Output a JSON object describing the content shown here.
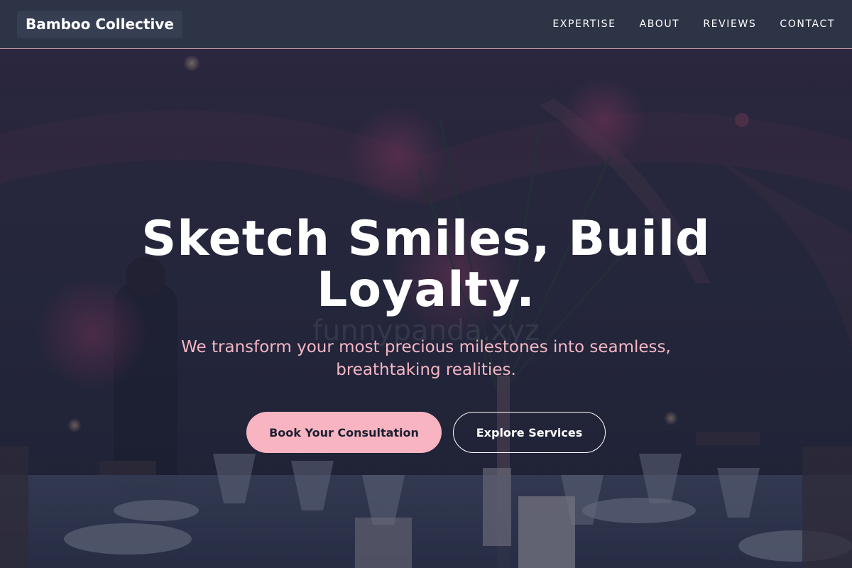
{
  "header": {
    "brand": "Bamboo Collective",
    "nav": [
      {
        "label": "EXPERTISE"
      },
      {
        "label": "ABOUT"
      },
      {
        "label": "REVIEWS"
      },
      {
        "label": "CONTACT"
      }
    ]
  },
  "hero": {
    "title": "Sketch Smiles, Build Loyalty.",
    "subtitle": "We transform your most precious milestones into seamless, breathtaking realities.",
    "watermark": "funnypanda.xyz",
    "primary_cta": "Book Your Consultation",
    "secondary_cta": "Explore Services"
  },
  "colors": {
    "header_bg": "#2d3446",
    "accent_pink": "#f8b4c1",
    "subtitle_pink": "#f4b6c4",
    "overlay": "#1c2034"
  }
}
